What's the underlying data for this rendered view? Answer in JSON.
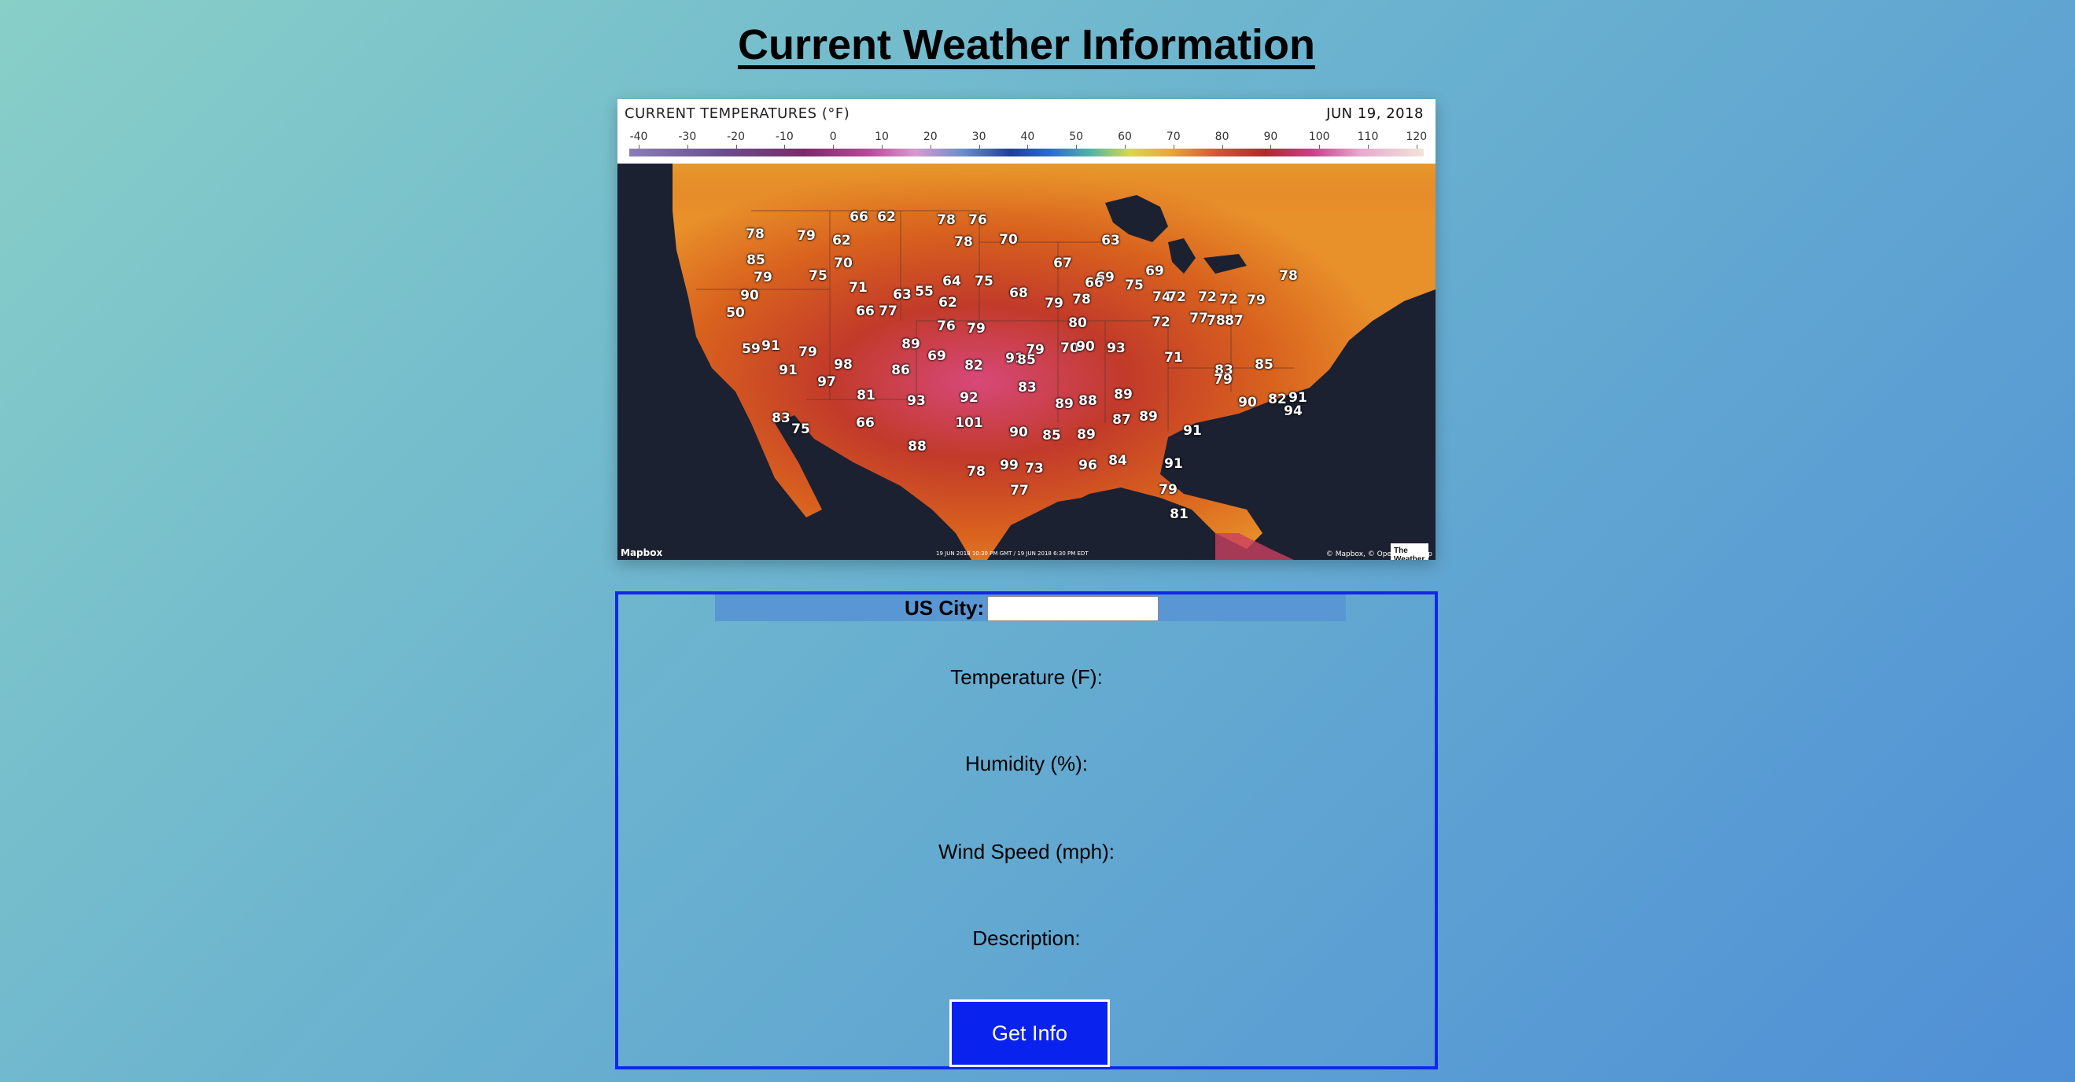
{
  "page": {
    "title": "Current Weather Information"
  },
  "map": {
    "header_title": "CURRENT TEMPERATURES (°F)",
    "date": "JUN 19, 2018",
    "scale_labels": [
      "-40",
      "-30",
      "-20",
      "-10",
      "0",
      "10",
      "20",
      "30",
      "40",
      "50",
      "60",
      "70",
      "80",
      "90",
      "100",
      "110",
      "120"
    ],
    "attribution_left": "Mapbox",
    "timestamp": "19 JUN 2018 10:30 PM GMT / 19 JUN 2018 6:30 PM EDT",
    "attribution_right": "© Mapbox, © OpenStreetMap",
    "logo_text": "The Weather Channel",
    "temperatures": [
      "78",
      "79",
      "62",
      "66",
      "62",
      "70",
      "78",
      "76",
      "78",
      "70",
      "63",
      "85",
      "79",
      "75",
      "71",
      "63",
      "55",
      "64",
      "75",
      "67",
      "69",
      "69",
      "90",
      "50",
      "66",
      "77",
      "62",
      "68",
      "79",
      "78",
      "66",
      "75",
      "74",
      "72",
      "72",
      "72",
      "79",
      "78",
      "59",
      "91",
      "79",
      "89",
      "76",
      "69",
      "79",
      "70",
      "80",
      "72",
      "77",
      "78",
      "87",
      "91",
      "98",
      "86",
      "82",
      "91",
      "79",
      "90",
      "93",
      "71",
      "83",
      "85",
      "97",
      "81",
      "93",
      "92",
      "83",
      "89",
      "88",
      "89",
      "79",
      "90",
      "82",
      "91",
      "94",
      "83",
      "75",
      "66",
      "101",
      "90",
      "85",
      "89",
      "87",
      "89",
      "91",
      "88",
      "99",
      "73",
      "78",
      "96",
      "84",
      "91",
      "77",
      "79",
      "81",
      "85"
    ]
  },
  "form": {
    "city_label": "US City:",
    "city_value": "",
    "temperature_label": "Temperature (F):",
    "humidity_label": "Humidity (%):",
    "wind_label": "Wind Speed (mph):",
    "description_label": "Description:",
    "button_label": "Get Info"
  },
  "colors": {
    "form_border": "#1228e8",
    "button_bg": "#0a22ee",
    "city_row_bg": "#5897d3"
  }
}
